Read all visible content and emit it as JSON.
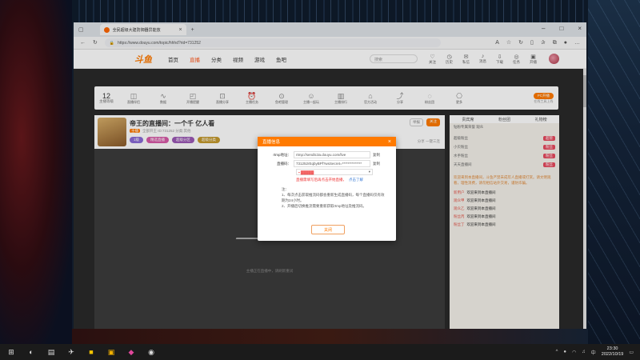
{
  "browser": {
    "tab_title": "全民超级大建防御器异能放",
    "url": "https://www.douyu.com/topic/hhhd?rid=731252"
  },
  "header": {
    "logo": "斗鱼",
    "nav": [
      "首页",
      "直播",
      "分类",
      "视频",
      "游戏",
      "鱼吧"
    ],
    "search_placeholder": "搜索",
    "icons": [
      {
        "label": "关注",
        "icon": "heart-icon"
      },
      {
        "label": "历史",
        "icon": "history-icon"
      },
      {
        "label": "私信",
        "icon": "message-icon"
      },
      {
        "label": "消息",
        "icon": "bell-icon"
      },
      {
        "label": "下载",
        "icon": "download-icon"
      },
      {
        "label": "任务",
        "icon": "task-icon"
      },
      {
        "label": "开播",
        "icon": "broadcast-icon"
      }
    ]
  },
  "toolbar": {
    "level": "12",
    "level_label": "主播等级",
    "items": [
      "直播伴侣",
      "数据",
      "开播提醒",
      "直播分享",
      "主播任务",
      "鱼吧管理",
      "主播一起玩",
      "主播排行",
      "官方活动",
      "分享",
      "粉丝团",
      "更多"
    ],
    "pc_button": "PC开播",
    "pc_sub": "在线工具上线"
  },
  "stream": {
    "title": "帝王的直播间：一个千 亿人看",
    "meta_tag": "主播",
    "meta": "全部开王  ID:731252  分类:其他",
    "pills": [
      "1级",
      "精选直播",
      "超级分区",
      "超级分类"
    ],
    "report": "举报",
    "follow": "关注",
    "share": "分享  一键三连",
    "player_tip": "主播正在直播中，请刷新重试"
  },
  "sidebar": {
    "tabs": [
      "贵宾席",
      "粉丝团",
      "礼物榜"
    ],
    "sub": "钻粉专属荣誉  观众",
    "list": [
      {
        "name": "超级粉丝",
        "tag": "超管"
      },
      {
        "name": "小贝粉丝",
        "tag": "粉丝"
      },
      {
        "name": "水手粉丝",
        "tag": "粉丝"
      },
      {
        "name": "天天直播间",
        "tag": "粉丝"
      }
    ],
    "chat_notice": "欢迎来到本直播间，斗鱼严禁未成年人直播或打赏。请文明观看，理性消费，请勿相信站外交易，谨防诈骗。",
    "messages": [
      {
        "user": "新用户",
        "text": "欢迎来到本直播间"
      },
      {
        "user": "观众甲",
        "text": "欢迎来到本直播间"
      },
      {
        "user": "观众乙",
        "text": "欢迎来到本直播间"
      },
      {
        "user": "粉丝丙",
        "text": "欢迎来到本直播间"
      },
      {
        "user": "粉丝丁",
        "text": "欢迎来到本直播间"
      }
    ]
  },
  "dialog": {
    "title": "直播信息",
    "rtmp_label": "rtmp地址：",
    "rtmp_value": "rtmp://sendtc3a.douyu.com/live",
    "code_label": "直播码：",
    "code_value": "731252rEqbyBPf?wsSecret=**************",
    "copy_label": "复制",
    "select_value": "▪ ▓▓▓▓▓",
    "warn_text": "直播需填写后再点击开始直播，",
    "warn_link": "点击了解",
    "notes_title": "注：",
    "note_1": "1、每次点击获取推流码都会重新生成直播码，每个直播码仅有效期为24小时。",
    "note_2": "2、开播后切换推流需要重新获取rtmp地址及推流码。",
    "close_label": "关闭"
  },
  "taskbar": {
    "time": "23:30",
    "date": "2022/10/19"
  }
}
